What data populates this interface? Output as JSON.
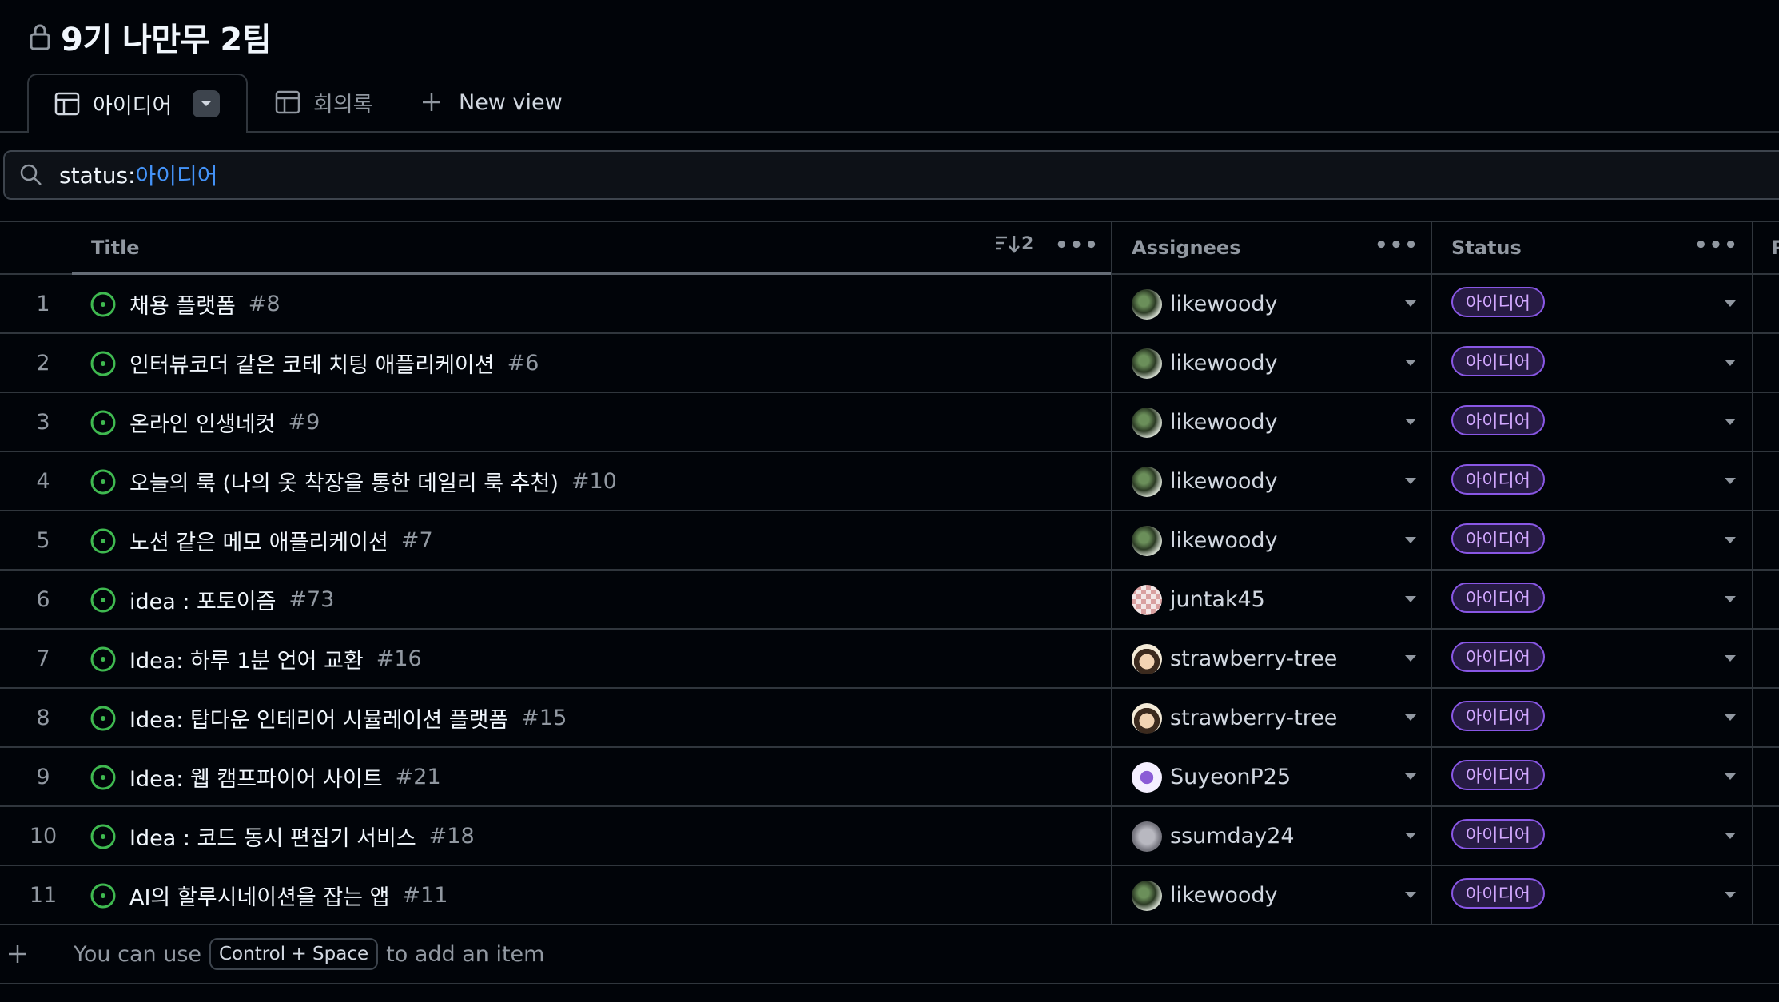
{
  "project": {
    "title": "9기 나만무 2팀",
    "lock_icon": "lock-icon"
  },
  "tabs": [
    {
      "label": "아이디어",
      "icon": "table-icon",
      "active": true
    },
    {
      "label": "회의록",
      "icon": "table-icon",
      "active": false
    }
  ],
  "new_view_label": "New view",
  "filter": {
    "key": "status:",
    "value": "아이디어"
  },
  "columns": {
    "title": "Title",
    "sort_count": "2",
    "assignees": "Assignees",
    "status": "Status",
    "next": "P"
  },
  "rows": [
    {
      "num": "1",
      "title": "채용 플랫폼",
      "issue": "#8",
      "assignee": "likewoody",
      "status": "아이디어"
    },
    {
      "num": "2",
      "title": "인터뷰코더 같은 코테 치팅 애플리케이션",
      "issue": "#6",
      "assignee": "likewoody",
      "status": "아이디어"
    },
    {
      "num": "3",
      "title": "온라인 인생네컷",
      "issue": "#9",
      "assignee": "likewoody",
      "status": "아이디어"
    },
    {
      "num": "4",
      "title": "오늘의 룩 (나의 옷 착장을 통한 데일리 룩 추천)",
      "issue": "#10",
      "assignee": "likewoody",
      "status": "아이디어"
    },
    {
      "num": "5",
      "title": "노션 같은 메모 애플리케이션",
      "issue": "#7",
      "assignee": "likewoody",
      "status": "아이디어"
    },
    {
      "num": "6",
      "title": "idea : 포토이즘",
      "issue": "#73",
      "assignee": "juntak45",
      "status": "아이디어"
    },
    {
      "num": "7",
      "title": "Idea: 하루 1분 언어 교환",
      "issue": "#16",
      "assignee": "strawberry-tree",
      "status": "아이디어"
    },
    {
      "num": "8",
      "title": "Idea: 탑다운 인테리어 시뮬레이션 플랫폼",
      "issue": "#15",
      "assignee": "strawberry-tree",
      "status": "아이디어"
    },
    {
      "num": "9",
      "title": "Idea: 웹 캠프파이어 사이트",
      "issue": "#21",
      "assignee": "SuyeonP25",
      "status": "아이디어"
    },
    {
      "num": "10",
      "title": "Idea : 코드 동시 편집기 서비스",
      "issue": "#18",
      "assignee": "ssumday24",
      "status": "아이디어"
    },
    {
      "num": "11",
      "title": "AI의 할루시네이션을 잡는 앱",
      "issue": "#11",
      "assignee": "likewoody",
      "status": "아이디어"
    }
  ],
  "add_item": {
    "prefix": "You can use",
    "kbd": "Control + Space",
    "suffix": "to add an item"
  },
  "colors": {
    "status_badge_border": "#8957e5",
    "status_badge_text": "#d2a8ff",
    "open_issue": "#3fb950",
    "link": "#4493f8"
  }
}
